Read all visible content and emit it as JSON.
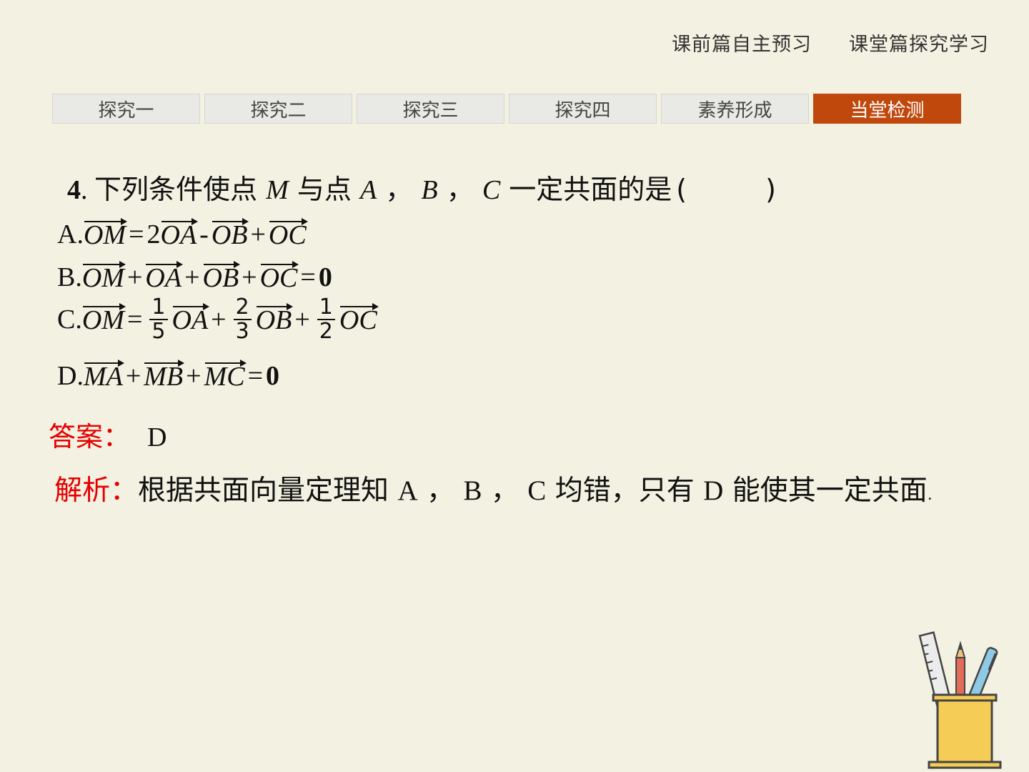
{
  "header": {
    "links": [
      "课前篇自主预习",
      "课堂篇探究学习"
    ]
  },
  "tabs": [
    {
      "label": "探究一",
      "active": false
    },
    {
      "label": "探究二",
      "active": false
    },
    {
      "label": "探究三",
      "active": false
    },
    {
      "label": "探究四",
      "active": false
    },
    {
      "label": "素养形成",
      "active": false
    },
    {
      "label": "当堂检测",
      "active": true
    }
  ],
  "question": {
    "number": "4",
    "text_before": "下列条件使点",
    "point_m": "M",
    "text_mid": "与点",
    "points": [
      "A",
      "B",
      "C"
    ],
    "separator": "，",
    "text_after": "一定共面的是",
    "paren_open": "(",
    "paren_close": ")"
  },
  "options": {
    "a": {
      "label": "A.",
      "v1": "OM",
      "eq": "=",
      "coef": "2",
      "v2": "OA",
      "m1": "-",
      "v3": "OB",
      "p1": "+",
      "v4": "OC"
    },
    "b": {
      "label": "B.",
      "v1": "OM",
      "p1": "+",
      "v2": "OA",
      "p2": "+",
      "v3": "OB",
      "p3": "+",
      "v4": "OC",
      "eq": "=",
      "zero": "0"
    },
    "c": {
      "label": "C.",
      "v1": "OM",
      "eq": "=",
      "f1_num": "1",
      "f1_den": "5",
      "v2": "OA",
      "p1": "+",
      "f2_num": "2",
      "f2_den": "3",
      "v3": "OB",
      "p2": "+",
      "f3_num": "1",
      "f3_den": "2",
      "v4": "OC"
    },
    "d": {
      "label": "D.",
      "v1": "MA",
      "p1": "+",
      "v2": "MB",
      "p2": "+",
      "v3": "MC",
      "eq": "=",
      "zero": "0"
    }
  },
  "answer": {
    "label": "答案：",
    "value": "D"
  },
  "analysis": {
    "label": "解析：",
    "text1": "根据共面向量定理知",
    "a": "A",
    "b": "B",
    "c": "C",
    "sep": "，",
    "text2": "均错，只有",
    "d": "D",
    "text3": "能使其一定共面",
    "end": "."
  },
  "colors": {
    "background": "#f3f1e1",
    "active_tab": "#c0480c",
    "label_red": "#e50000"
  },
  "decoration": {
    "icon": "pencil-cup-icon"
  }
}
